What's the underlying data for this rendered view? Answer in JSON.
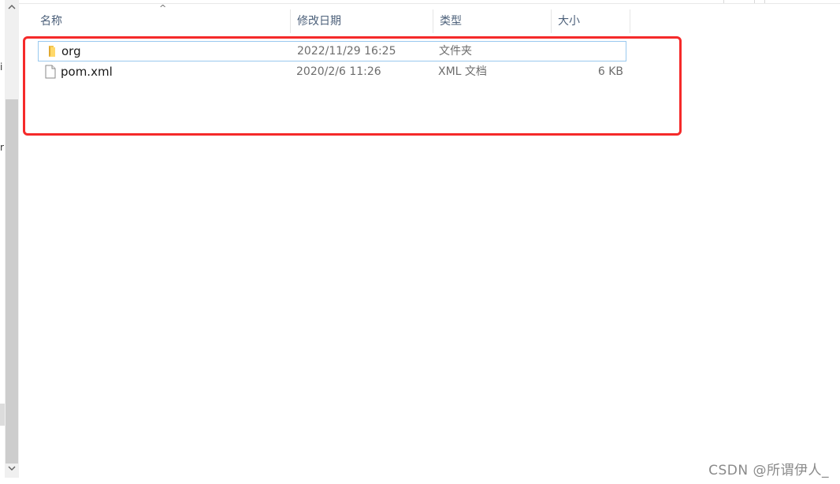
{
  "nav_fragments": [
    "i",
    "r"
  ],
  "columns": {
    "name": "名称",
    "modified": "修改日期",
    "type": "类型",
    "size": "大小"
  },
  "sort_indicator": "^",
  "files": [
    {
      "name": "org",
      "modified": "2022/11/29 16:25",
      "type": "文件夹",
      "size": "",
      "icon": "folder-icon"
    },
    {
      "name": "pom.xml",
      "modified": "2020/2/6 11:26",
      "type": "XML 文档",
      "size": "6 KB",
      "icon": "file-icon"
    }
  ],
  "watermark": "CSDN @所谓伊人_",
  "colors": {
    "annotation": "#f52a2a",
    "selection_border": "#99c9ef",
    "header_text": "#4c607a"
  }
}
